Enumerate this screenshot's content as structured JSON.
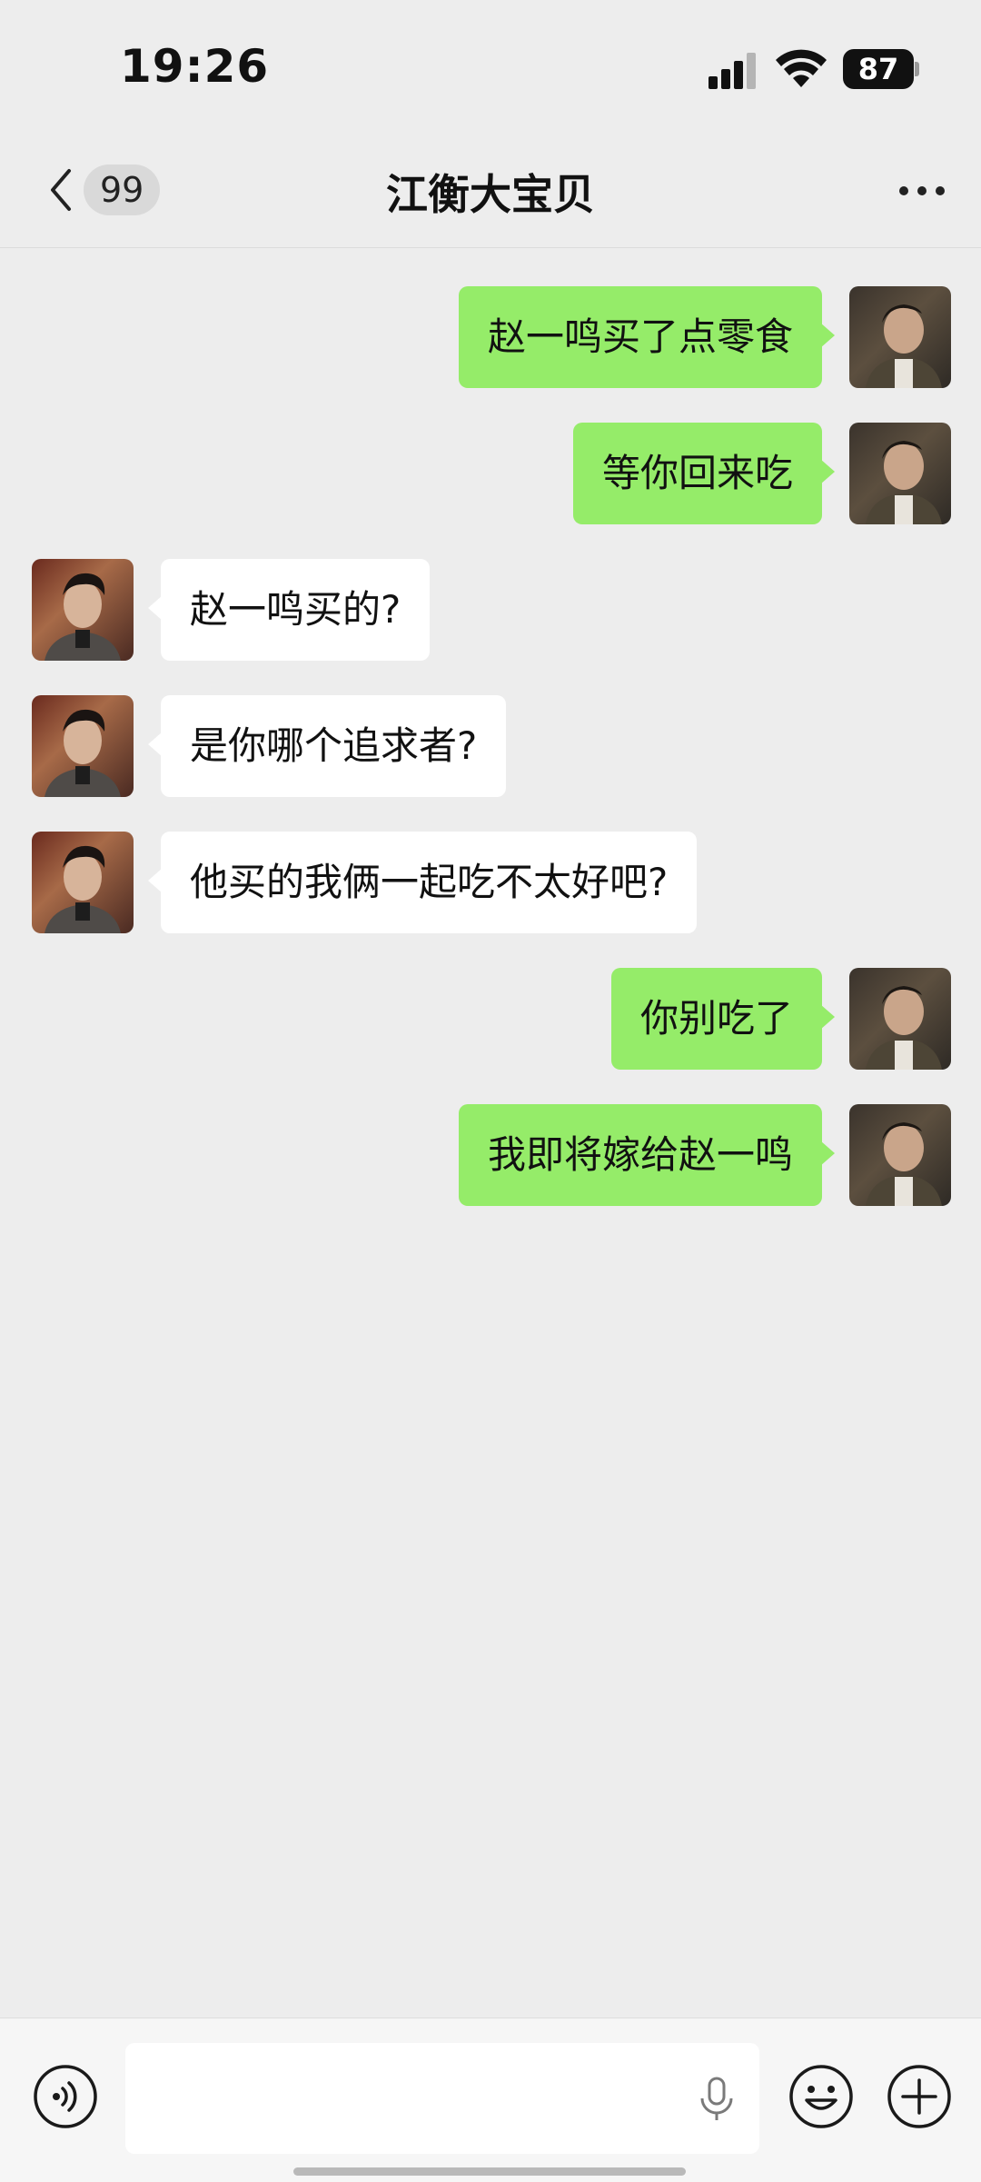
{
  "status_bar": {
    "time": "19:26",
    "battery": "87"
  },
  "nav": {
    "unread_count": "99",
    "title": "江衡大宝贝"
  },
  "messages": [
    {
      "sender": "me",
      "text": "赵一鸣买了点零食"
    },
    {
      "sender": "me",
      "text": "等你回来吃"
    },
    {
      "sender": "other",
      "text": "赵一鸣买的?"
    },
    {
      "sender": "other",
      "text": "是你哪个追求者?"
    },
    {
      "sender": "other",
      "text": "他买的我俩一起吃不太好吧?"
    },
    {
      "sender": "me",
      "text": "你别吃了"
    },
    {
      "sender": "me",
      "text": "我即将嫁给赵一鸣"
    }
  ],
  "input_bar": {
    "icons": [
      "voice-icon",
      "mic-icon",
      "emoji-icon",
      "plus-icon"
    ]
  },
  "colors": {
    "background": "#ededed",
    "my_bubble": "#95ec69",
    "their_bubble": "#ffffff"
  }
}
